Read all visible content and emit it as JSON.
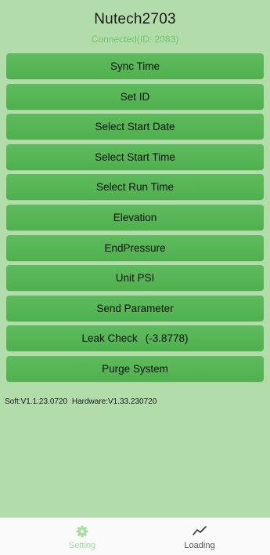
{
  "header": {
    "title": "Nutech2703",
    "status": "Connected(ID: 2083)"
  },
  "buttons": [
    {
      "label": "Sync Time"
    },
    {
      "label": "Set ID"
    },
    {
      "label": "Select Start Date"
    },
    {
      "label": "Select Start Time"
    },
    {
      "label": "Select Run Time"
    },
    {
      "label": "Elevation"
    },
    {
      "label": "EndPressure"
    },
    {
      "label": "Unit PSI"
    },
    {
      "label": "Send Parameter"
    },
    {
      "label": "Leak Check",
      "value": "(-3.8778)"
    },
    {
      "label": "Purge System"
    }
  ],
  "version": {
    "soft": "Soft:V1.1.23.0720",
    "hardware": "Hardware:V1.33.230720"
  },
  "tabbar": {
    "tabs": [
      {
        "label": "Setting",
        "icon": "gear-icon",
        "active": true,
        "color": "#9fd89b"
      },
      {
        "label": "Loading",
        "icon": "trend-line-icon",
        "active": false,
        "color": "#555555"
      }
    ]
  },
  "colors": {
    "background": "#b3dcab",
    "button": "#55b554",
    "status": "#6fc66c"
  }
}
